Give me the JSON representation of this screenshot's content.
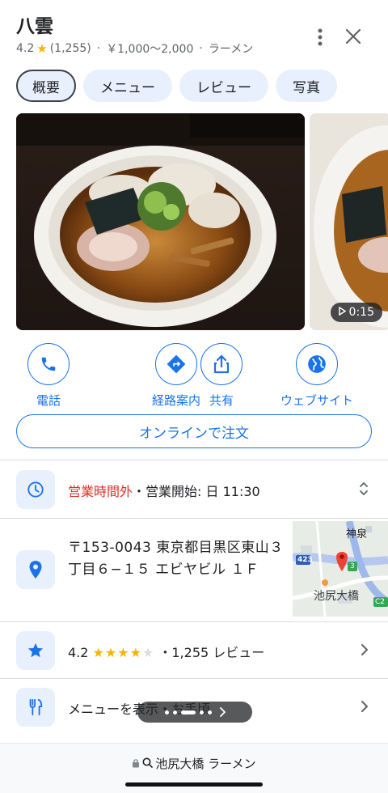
{
  "place": {
    "name": "八雲",
    "rating": "4.2",
    "review_count": "(1,255)",
    "price": "￥1,000〜2,000",
    "category": "ラーメン"
  },
  "tabs": [
    {
      "label": "概要"
    },
    {
      "label": "メニュー"
    },
    {
      "label": "レビュー"
    },
    {
      "label": "写真"
    }
  ],
  "photos": {
    "video_duration": "0:15"
  },
  "actions": [
    {
      "label": "電話",
      "icon": "phone-icon"
    },
    {
      "label": "経路案内",
      "icon": "directions-icon"
    },
    {
      "label": "共有",
      "icon": "share-icon"
    },
    {
      "label": "ウェブサイト",
      "icon": "globe-icon"
    }
  ],
  "order_button": "オンラインで注文",
  "hours": {
    "status": "営業時間外",
    "separator": "・",
    "next_open": "営業開始: 日 11:30"
  },
  "address": {
    "text": "〒153-0043 東京都目黒区東山３丁目６−１５ エビヤビル １Ｆ",
    "map_labels": {
      "district": "神泉",
      "route": "423",
      "station": "池尻大橋",
      "badge": "3",
      "route2": "C2"
    }
  },
  "rating_row": {
    "rating": "4.2",
    "dot": "・",
    "reviews": "1,255 レビュー",
    "stars_filled": 4,
    "stars_total": 5
  },
  "menu_row": {
    "label": "メニューを表示・お手頃"
  },
  "browser": {
    "url": "池尻大橋 ラーメン"
  },
  "colors": {
    "accent": "#1a73e8",
    "closed": "#d93025",
    "star": "#f4b400",
    "chip_bg": "#e8f0fe"
  }
}
